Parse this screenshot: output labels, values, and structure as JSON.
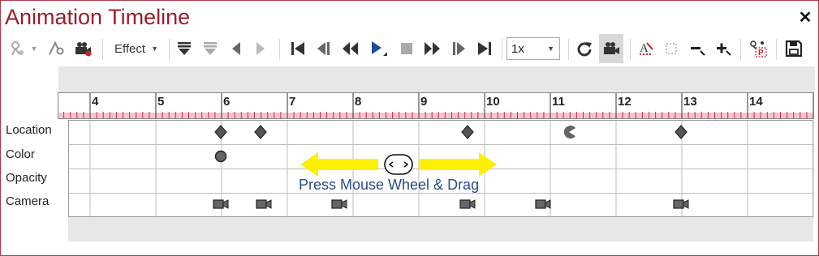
{
  "window": {
    "title": "Animation Timeline",
    "close_glyph": "✕"
  },
  "toolbar": {
    "effect_label": "Effect",
    "speed": {
      "value": "1x",
      "options": [
        "1x"
      ]
    },
    "icons": [
      "add-location-key-icon",
      "dropdown-arrow-icon",
      "remove-location-key-icon",
      "camera-key-icon",
      "effect-dropdown",
      "move-keys-down-icon",
      "move-keys-down-disabled-icon",
      "previous-key-icon",
      "next-key-icon",
      "go-to-start-icon",
      "step-back-icon",
      "rewind-icon",
      "play-icon",
      "stop-icon",
      "fast-forward-icon",
      "step-forward-icon",
      "go-to-end-icon",
      "loop-icon",
      "camera-view-icon",
      "text-tool-icon",
      "zoom-fit-icon",
      "zoom-out-icon",
      "zoom-in-icon",
      "export-icon",
      "save-icon"
    ]
  },
  "ruler": {
    "labels": [
      "4",
      "5",
      "6",
      "7",
      "8",
      "9",
      "10",
      "11",
      "12",
      "13",
      "14"
    ]
  },
  "tracks": [
    {
      "name": "Location"
    },
    {
      "name": "Color"
    },
    {
      "name": "Opacity"
    },
    {
      "name": "Camera"
    }
  ],
  "keyframes": {
    "location": [
      6.0,
      6.6,
      9.75,
      11.3,
      13.0
    ],
    "color": [
      6.0
    ],
    "camera": [
      6.0,
      6.65,
      7.8,
      9.75,
      10.9,
      13.0
    ]
  },
  "hint": {
    "text": "Press Mouse Wheel & Drag"
  },
  "colors": {
    "title": "#9b1c2c",
    "ruler_pink": "#f4a9b7",
    "arrow_yellow": "#ffef00",
    "hint_blue": "#2c4a8a",
    "accent": "#1f4e9c"
  }
}
